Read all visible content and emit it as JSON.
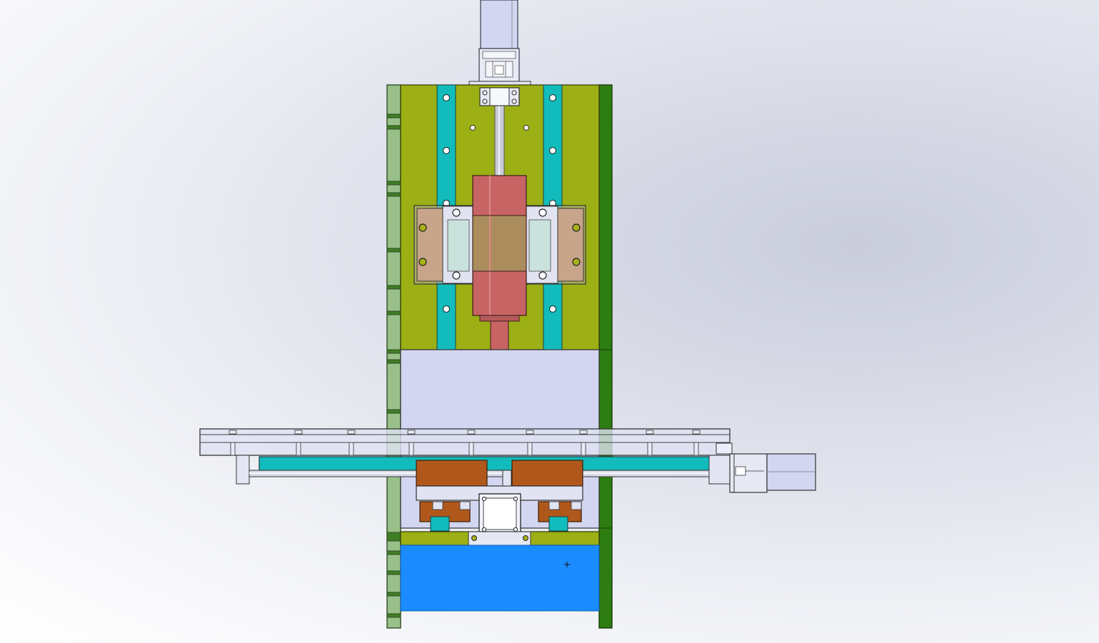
{
  "app": {
    "name": "",
    "document": "",
    "view": ""
  },
  "colors": {
    "background_top": "#ffffff",
    "background_mid": "#dde0ea",
    "plate_yellow_green": "#9caf14",
    "rail_teal": "#12bcbc",
    "side_plate_green": "#2e7d12",
    "side_plate_light_green": "#9ac08a",
    "spindle_red": "#c86464",
    "block_brown": "#b0581c",
    "pad_tan": "#c8a48a",
    "steel_light": "#d3d6f0",
    "base_blue": "#1a8cff"
  },
  "icons": {
    "cursor": "crosshair-cursor-icon"
  }
}
